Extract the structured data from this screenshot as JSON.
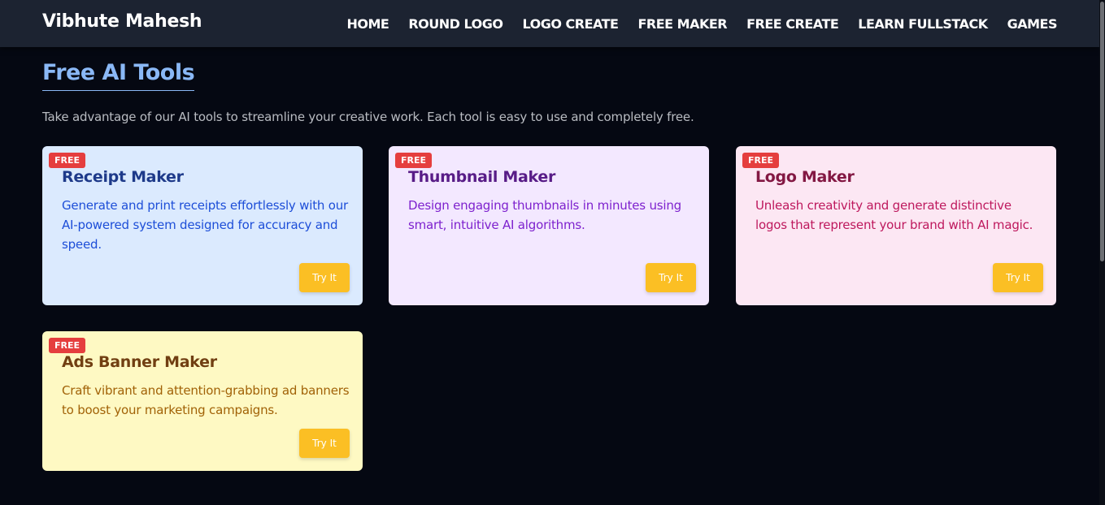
{
  "brand": "Vibhute Mahesh",
  "nav": [
    "HOME",
    "ROUND LOGO",
    "LOGO CREATE",
    "FREE MAKER",
    "FREE CREATE",
    "LEARN FULLSTACK",
    "GAMES"
  ],
  "section": {
    "title": "Free AI Tools",
    "intro": "Take advantage of our AI tools to streamline your creative work. Each tool is easy to use and completely free."
  },
  "cards": [
    {
      "badge": "FREE",
      "title": "Receipt Maker",
      "description": "Generate and print receipts effortlessly with our AI-powered system designed for accuracy and speed.",
      "button": "Try It",
      "bg_color": "#dbeafe",
      "title_color": "#1e3a8a",
      "text_color": "#1d4ed8"
    },
    {
      "badge": "FREE",
      "title": "Thumbnail Maker",
      "description": "Design engaging thumbnails in minutes using smart, intuitive AI algorithms.",
      "button": "Try It",
      "bg_color": "#f3e8ff",
      "title_color": "#581c87",
      "text_color": "#7e22ce"
    },
    {
      "badge": "FREE",
      "title": "Logo Maker",
      "description": "Unleash creativity and generate distinctive logos that represent your brand with AI magic.",
      "button": "Try It",
      "bg_color": "#fce7f3",
      "title_color": "#831843",
      "text_color": "#be185d"
    },
    {
      "badge": "FREE",
      "title": "Ads Banner Maker",
      "description": "Craft vibrant and attention-grabbing ad banners to boost your marketing campaigns.",
      "button": "Try It",
      "bg_color": "#fef9c3",
      "title_color": "#713f12",
      "text_color": "#a16207"
    }
  ],
  "colors": {
    "page_bg": "#050812",
    "navbar_bg": "#1c2331",
    "accent_title": "#8ab8f6",
    "badge_bg": "#e53e3e",
    "button_bg": "#fbbf24"
  }
}
